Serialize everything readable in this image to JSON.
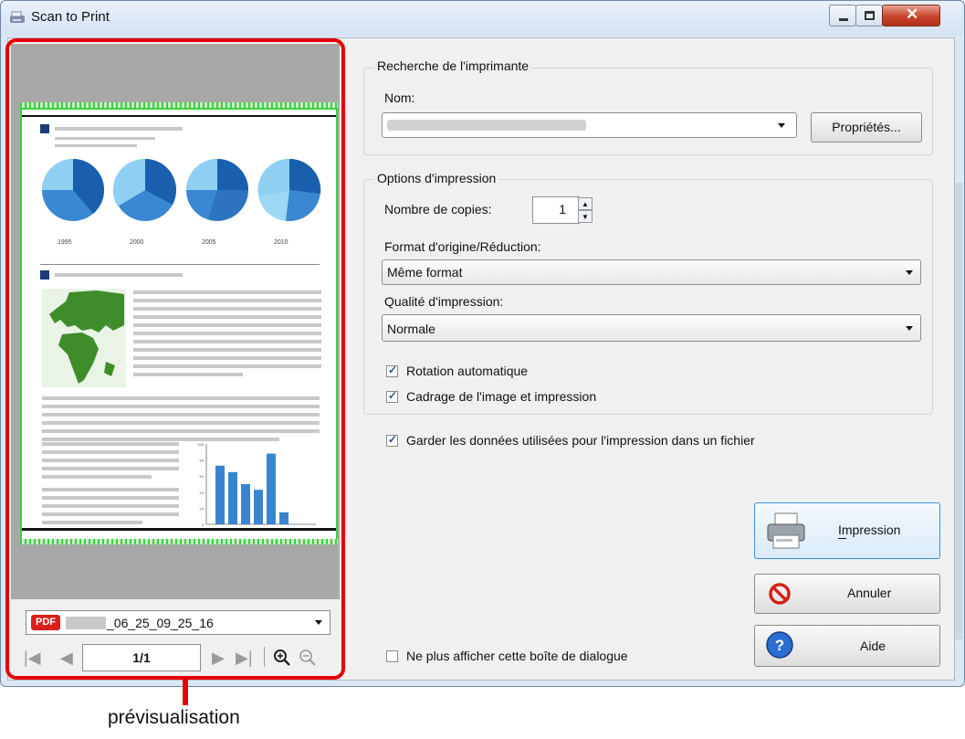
{
  "window": {
    "title": "Scan to Print"
  },
  "preview": {
    "file_name": "_06_25_09_25_16",
    "file_badge": "PDF",
    "page_indicator": "1/1",
    "years": [
      "1995",
      "2000",
      "2005",
      "2010"
    ],
    "bar_values": [
      73,
      65,
      50,
      43,
      88,
      15
    ],
    "chart_ticks": [
      "100",
      "80",
      "60",
      "40",
      "20",
      "0"
    ]
  },
  "printer_search": {
    "legend": "Recherche de l'imprimante",
    "name_label": "Nom:",
    "properties_button": "Propriétés..."
  },
  "print_options": {
    "legend": "Options d'impression",
    "copies_label": "Nombre de copies:",
    "copies_value": "1",
    "format_label": "Format d'origine/Réduction:",
    "format_value": "Même format",
    "quality_label": "Qualité d'impression:",
    "quality_value": "Normale",
    "auto_rotation": "Rotation automatique",
    "crop_print": "Cadrage de l'image et impression"
  },
  "keep_data_label": "Garder les données utilisées pour l'impression dans un fichier",
  "buttons": {
    "print": "Impression",
    "cancel": "Annuler",
    "help": "Aide"
  },
  "dont_show_label": "Ne plus afficher cette boîte de dialogue",
  "caption": "prévisualisation",
  "colors": {
    "highlight": "#e60000",
    "pie_dark": "#1a5fae",
    "pie_light": "#8fd0f2",
    "map_green": "#3f8c2a"
  }
}
